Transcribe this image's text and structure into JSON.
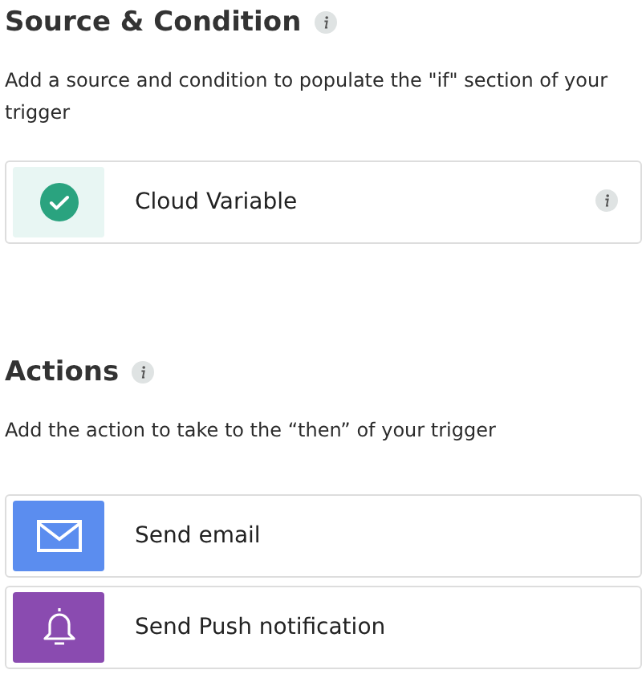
{
  "sections": [
    {
      "title": "Source & Condition",
      "description": "Add a source and condition to populate the \"if\" section of your trigger",
      "items": [
        {
          "label": "Cloud Variable",
          "kind": "check",
          "color": "#e8f6f3",
          "info": true
        }
      ]
    },
    {
      "title": "Actions",
      "description": "Add the action to take to the “then” of your trigger",
      "items": [
        {
          "label": "Send email",
          "kind": "mail",
          "color": "#5b8def",
          "info": false
        },
        {
          "label": "Send Push notification",
          "kind": "bell",
          "color": "#8a4bb0",
          "info": false
        }
      ]
    }
  ]
}
